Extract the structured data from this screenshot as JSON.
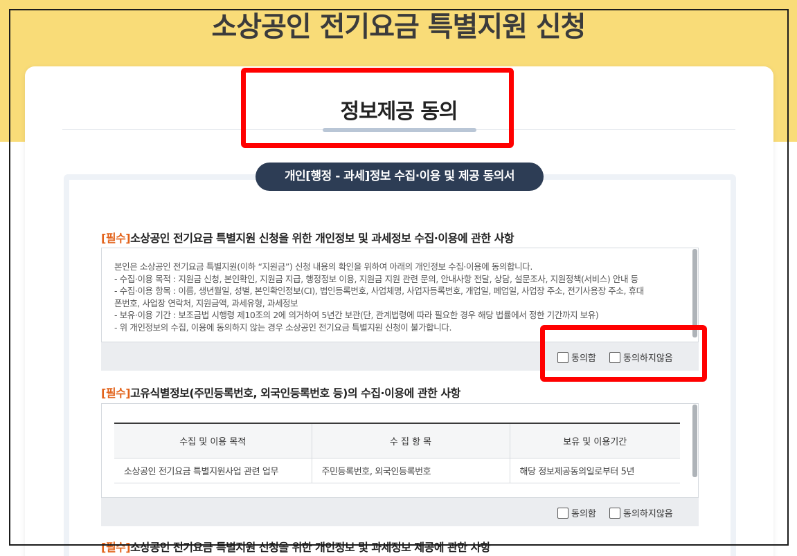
{
  "page": {
    "title": "소상공인 전기요금 특별지원 신청"
  },
  "section": {
    "title": "정보제공 동의"
  },
  "agreement": {
    "pill_title": "개인[행정 - 과세]정보 수집·이용 및 제공 동의서",
    "items": [
      {
        "required_tag": "[필수]",
        "heading": "소상공인 전기요금 특별지원 신청을 위한 개인정보 및 과세정보 수집·이용에 관한 사항",
        "body_lines": [
          "본인은 소상공인 전기요금 특별지원(이하 “지원금”) 신청 내용의 확인을 위하여 아래의 개인정보 수집·이용에 동의합니다.",
          "- 수집·이용 목적 : 지원금 신청, 본인확인, 지원금 지급, 행정정보 이용, 지원금 지원 관련 문의, 안내사항 전달, 상담, 설문조사, 지원정책(서비스) 안내 등",
          "- 수집·이용 항목 : 이름, 생년월일, 성별, 본인확인정보(CI), 법인등록번호, 사업체명, 사업자등록번호, 개업일, 폐업일, 사업장 주소, 전기사용장 주소, 휴대",
          "폰번호, 사업장 연락처, 지원금액, 과세유형, 과세정보",
          "- 보유·이용 기간 : 보조금법 시행령 제10조의 2에 의거하여 5년간 보관(단, 관계법령에 따라 필요한 경우 해당 법률에서 정한 기간까지 보유)",
          "- 위 개인정보의 수집, 이용에 동의하지 않는 경우 소상공인 전기요금 특별지원 신청이 불가합니다."
        ],
        "agree_label": "동의함",
        "disagree_label": "동의하지않음"
      },
      {
        "required_tag": "[필수]",
        "heading": "고유식별정보(주민등록번호, 외국인등록번호 등)의 수집·이용에 관한 사항",
        "table": {
          "headers": [
            "수집 및 이용 목적",
            "수 집 항 목",
            "보유 및 이용기간"
          ],
          "rows": [
            [
              "소상공인 전기요금 특별지원사업 관련 업무",
              "주민등록번호, 외국인등록번호",
              "해당 정보제공동의일로부터 5년"
            ]
          ]
        },
        "agree_label": "동의함",
        "disagree_label": "동의하지않음"
      },
      {
        "required_tag": "[필수]",
        "heading": "소상공인 전기요금 특별지원 신청을 위한 개인정보 및 과세정보 제공에 관한 사항"
      }
    ]
  },
  "colors": {
    "banner": "#f9dc78",
    "pill": "#2d3d55",
    "required_tag": "#e2621a",
    "highlight": "#ff0000"
  }
}
